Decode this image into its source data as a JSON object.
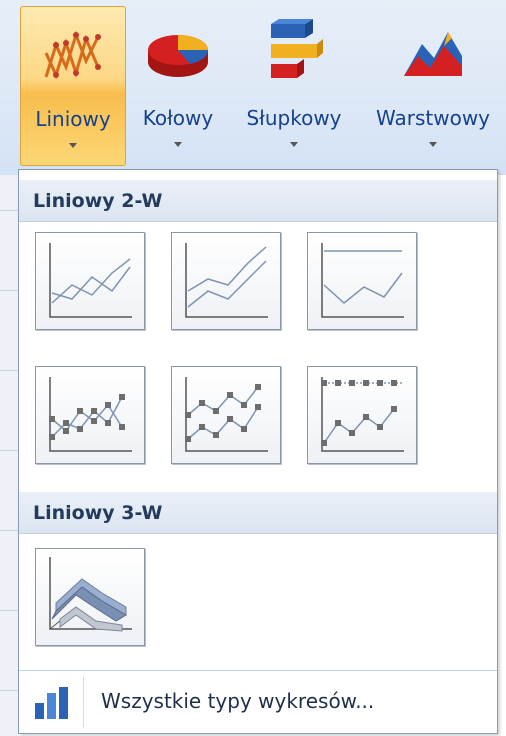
{
  "ribbon": {
    "buttons": [
      {
        "label": "Liniowy",
        "icon": "line-chart-icon"
      },
      {
        "label": "Kołowy",
        "icon": "pie-chart-icon"
      },
      {
        "label": "Słupkowy",
        "icon": "bar-chart-icon"
      },
      {
        "label": "Warstwowy",
        "icon": "area-chart-icon"
      }
    ]
  },
  "dropdown": {
    "section_2d": "Liniowy 2-W",
    "section_3d": "Liniowy 3-W",
    "items_2d": [
      "line",
      "stacked-line",
      "100-stacked-line",
      "line-markers",
      "stacked-line-markers",
      "100-stacked-line-markers"
    ],
    "items_3d": [
      "3d-line"
    ],
    "all_types_label": "Wszystkie typy wykresów..."
  },
  "colors": {
    "active_button": "#f8bd4d",
    "ribbon_label": "#15428b",
    "section_bg": "#dbe5f1"
  }
}
